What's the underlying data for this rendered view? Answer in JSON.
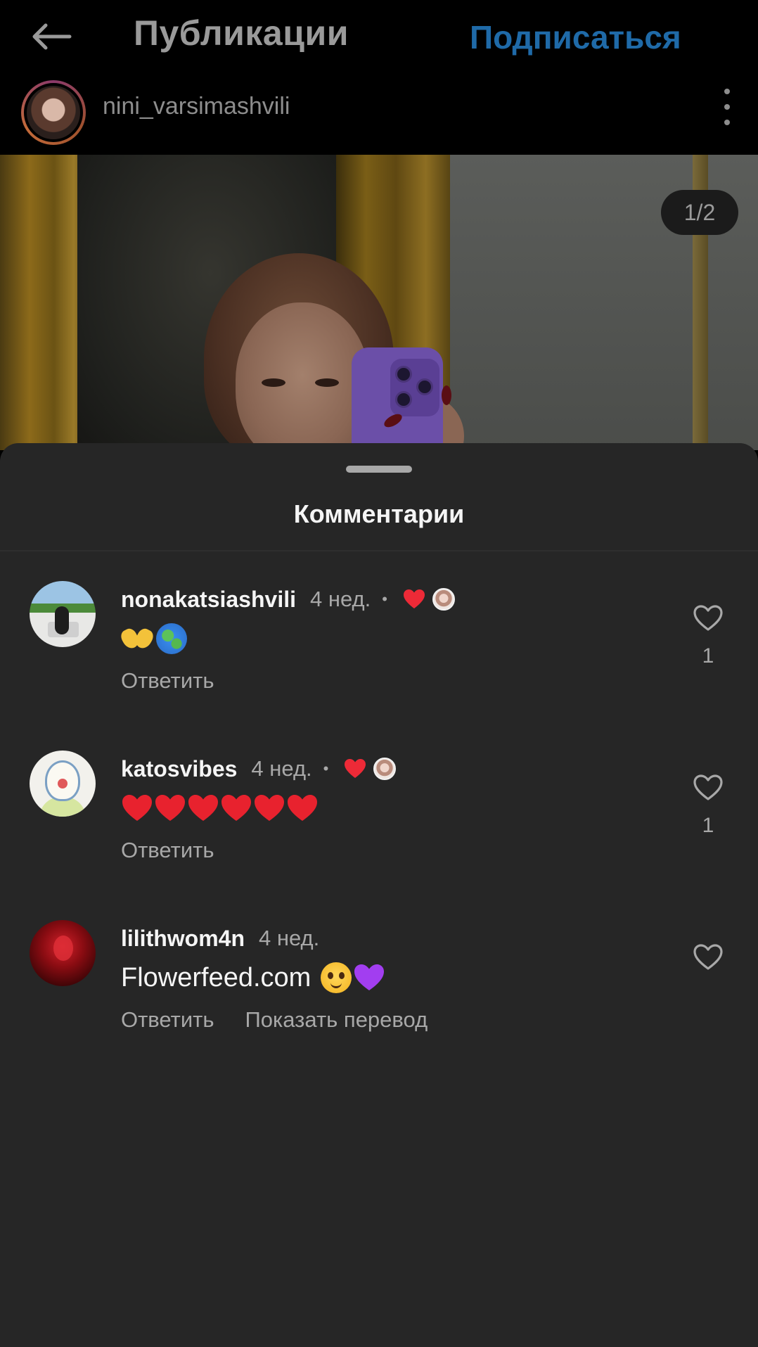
{
  "header": {
    "title": "Публикации",
    "subscribe_label": "Подписаться"
  },
  "post": {
    "author": "nini_varsimashvili",
    "slide_counter": "1/2"
  },
  "comments_sheet": {
    "title": "Комментарии",
    "comments": [
      {
        "username": "nonakatsiashvili",
        "time": "4 нед.",
        "separator": "•",
        "text_emojis": [
          "heart-hands",
          "globe"
        ],
        "reply_label": "Ответить",
        "likes": "1",
        "liked_by_author": true
      },
      {
        "username": "katosvibes",
        "time": "4 нед.",
        "separator": "•",
        "text_emojis": [
          "red-heart",
          "red-heart",
          "red-heart",
          "red-heart",
          "red-heart",
          "red-heart"
        ],
        "reply_label": "Ответить",
        "likes": "1",
        "liked_by_author": true
      },
      {
        "username": "lilithwom4n",
        "time": "4 нед.",
        "text": "Flowerfeed.com",
        "text_emojis": [
          "pleading-face",
          "purple-heart"
        ],
        "reply_label": "Ответить",
        "translate_label": "Показать перевод",
        "likes": ""
      }
    ]
  },
  "colors": {
    "background": "#000000",
    "sheet": "#262626",
    "accent_blue": "#1f6aa8",
    "like_red": "#ed2a37",
    "muted_text": "#a8a8a8"
  }
}
